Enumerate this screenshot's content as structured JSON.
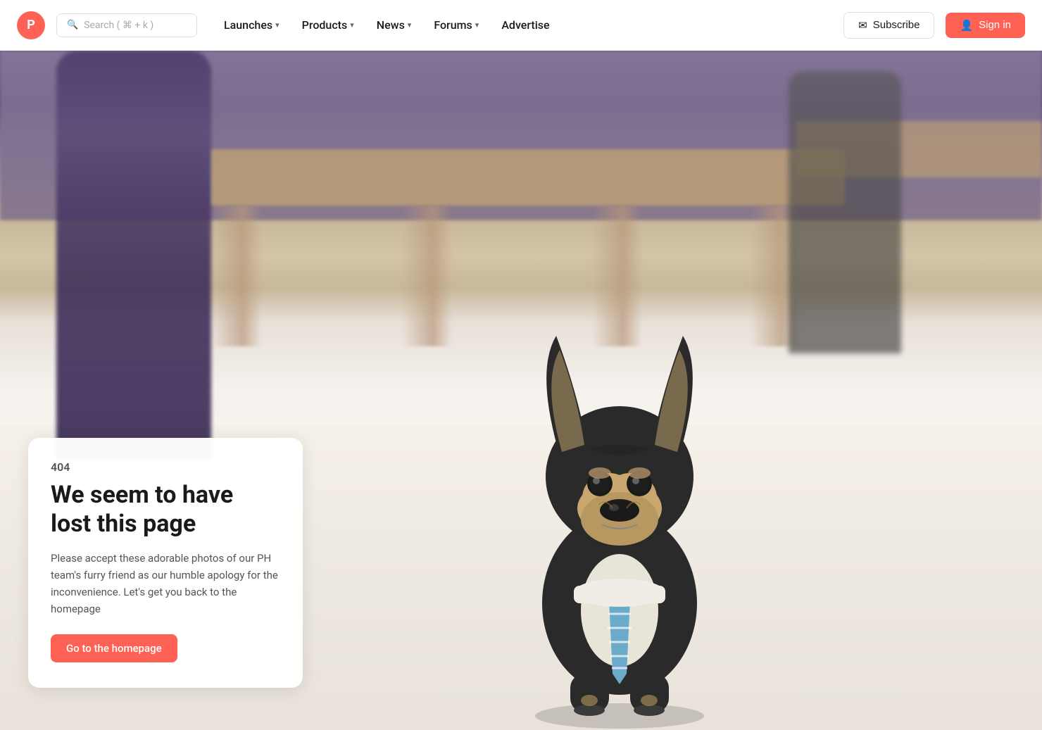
{
  "nav": {
    "logo_letter": "P",
    "search_placeholder": "Search ( ⌘ + k )",
    "links": [
      {
        "label": "Launches",
        "has_dropdown": true
      },
      {
        "label": "Products",
        "has_dropdown": true
      },
      {
        "label": "News",
        "has_dropdown": true
      },
      {
        "label": "Forums",
        "has_dropdown": true
      },
      {
        "label": "Advertise",
        "has_dropdown": false
      }
    ],
    "subscribe_label": "Subscribe",
    "signin_label": "Sign in"
  },
  "error": {
    "code": "404",
    "title_line1": "We seem to have",
    "title_line2": "lost this page",
    "description": "Please accept these adorable photos of our PH team's furry friend as our humble apology for the inconvenience. Let's get you back to the homepage",
    "cta_label": "Go to the homepage"
  },
  "colors": {
    "brand": "#ff6154",
    "nav_bg": "#ffffff",
    "text_primary": "#1a1a1a",
    "text_secondary": "#555555"
  }
}
